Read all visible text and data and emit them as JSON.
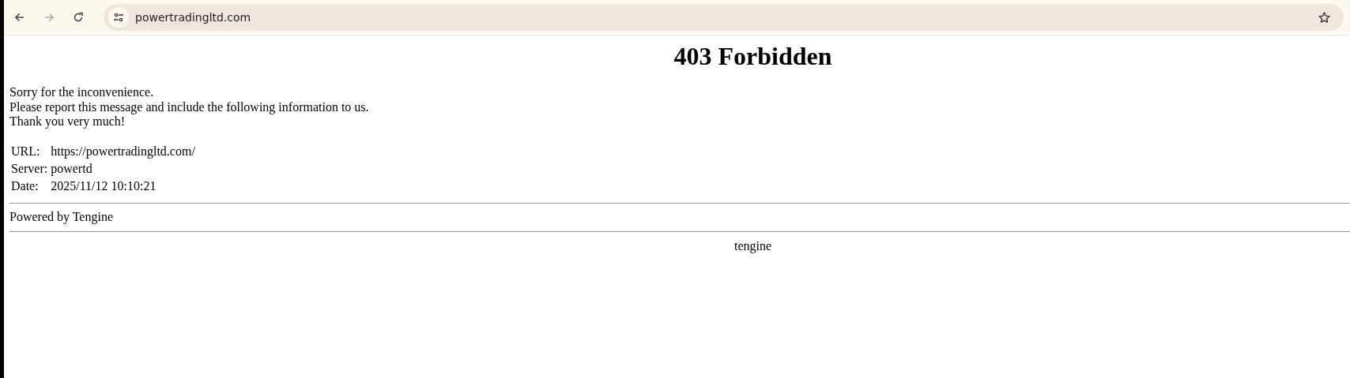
{
  "browser": {
    "address": "powertradingltd.com",
    "forward_disabled": true
  },
  "page": {
    "title": "403 Forbidden",
    "message_lines": [
      "Sorry for the inconvenience.",
      "Please report this message and include the following information to us.",
      "Thank you very much!"
    ],
    "info": [
      {
        "label": "URL:",
        "value": "https://powertradingltd.com/"
      },
      {
        "label": "Server:",
        "value": "powertd"
      },
      {
        "label": "Date:",
        "value": "2025/11/12 10:10:21"
      }
    ],
    "footer": "Powered by Tengine",
    "server_name": "tengine"
  }
}
